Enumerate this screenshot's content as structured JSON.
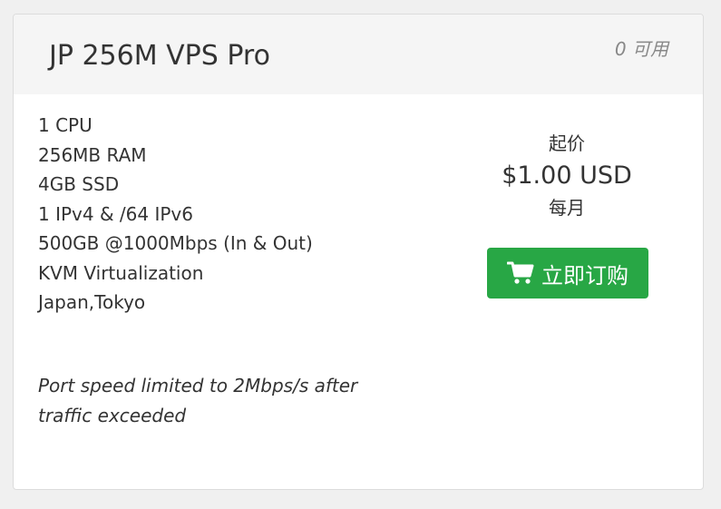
{
  "product": {
    "name": "JP 256M VPS Pro",
    "availability": "0 可用",
    "features": [
      "1 CPU",
      "256MB RAM",
      "4GB SSD",
      "1 IPv4 & /64 IPv6",
      "500GB @1000Mbps (In & Out)",
      "KVM Virtualization",
      "Japan,Tokyo"
    ],
    "note": "Port speed limited to 2Mbps/s after traffic exceeded"
  },
  "pricing": {
    "from_label": "起价",
    "amount": "$1.00 USD",
    "cycle": "每月"
  },
  "order_button": {
    "label": "立即订购",
    "icon": "shopping-cart-icon",
    "color": "#28a745"
  }
}
